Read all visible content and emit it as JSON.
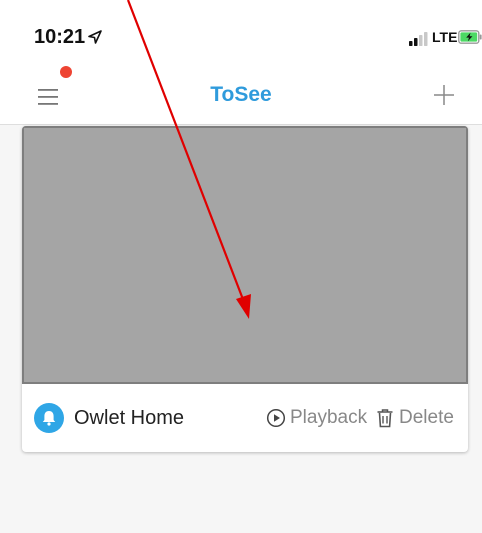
{
  "status_bar": {
    "time": "10:21",
    "network": "LTE",
    "battery_color": "#4cd964"
  },
  "nav": {
    "title": "ToSee",
    "title_color": "#2f9bdc",
    "notification_dot_color": "#ee4433",
    "menu_icon": "hamburger-menu-icon",
    "add_icon": "plus-icon"
  },
  "device_card": {
    "name": "Owlet Home",
    "icon": "bell-icon",
    "icon_bg": "#2fa6e6",
    "preview_color": "#a5a5a5",
    "actions": [
      {
        "label": "Playback",
        "icon": "play-circle-icon"
      },
      {
        "label": "Delete",
        "icon": "trash-icon"
      }
    ]
  },
  "annotation": {
    "arrow_color": "#e00000"
  }
}
